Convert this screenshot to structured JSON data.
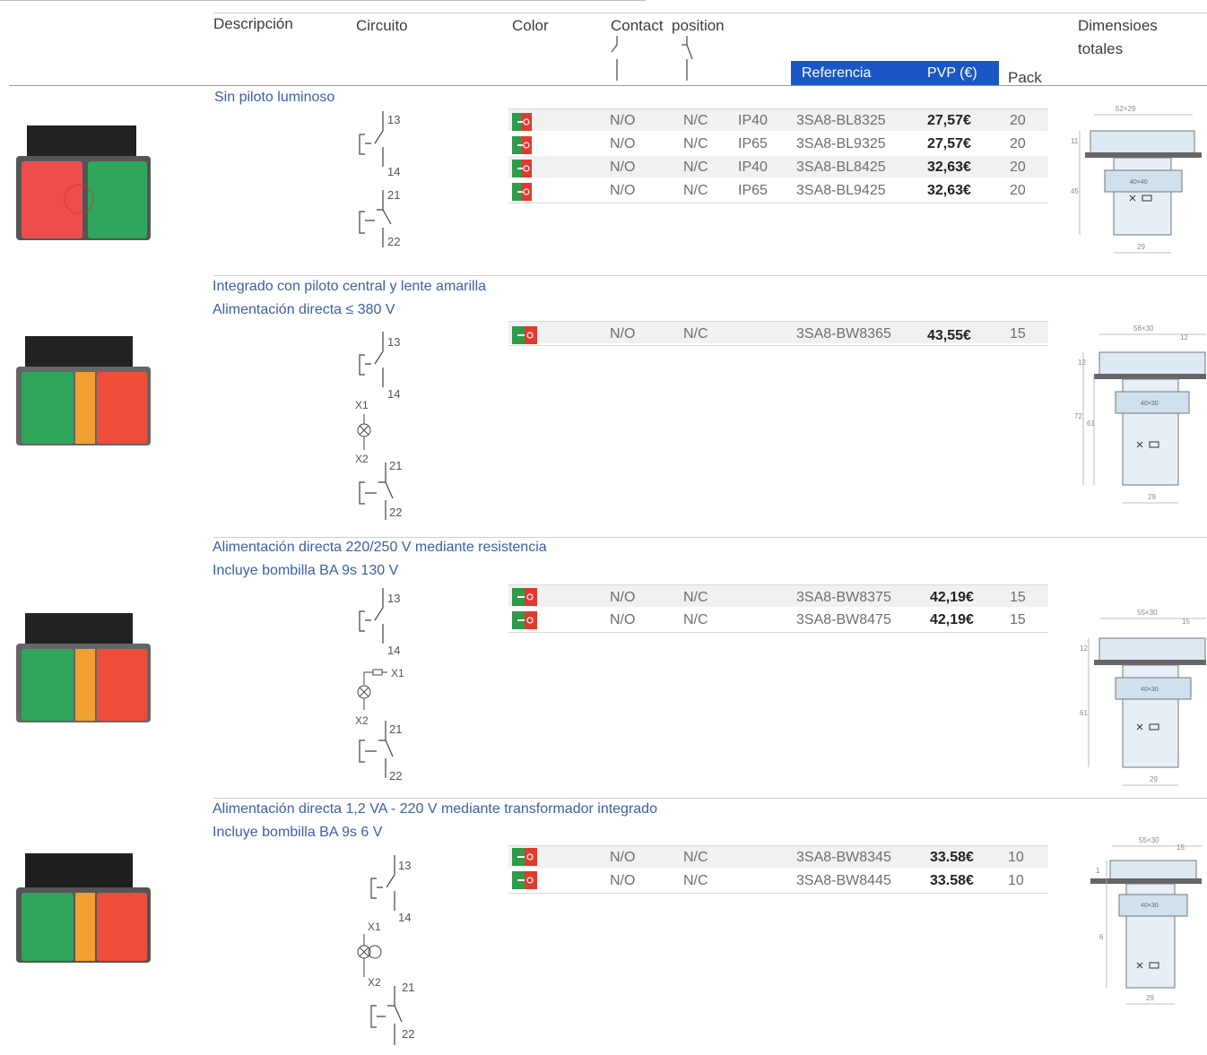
{
  "header": {
    "descripcion": "Descripción",
    "circuito": "Circuito",
    "color": "Color",
    "contact_position": "Contact  position",
    "referencia": "Referencia",
    "pvp": "PVP (€)",
    "pack": "Pack",
    "dimensiones_1": "Dimensioes",
    "dimensiones_2": "totales"
  },
  "colors": {
    "accent": "#1a57c4",
    "section_text": "#3b5fa6",
    "switch_green": "#2e9a4a",
    "switch_red": "#e03a2f"
  },
  "sections": [
    {
      "line1": "Sin piloto luminoso",
      "line2": "",
      "circuit_labels": [
        "13",
        "14",
        "21",
        "22"
      ],
      "rows": [
        {
          "no": "N/O",
          "nc": "N/C",
          "ip": "IP40",
          "ref": "3SA8-BL8325",
          "price": "27,57€",
          "pack": "20"
        },
        {
          "no": "N/O",
          "nc": "N/C",
          "ip": "IP65",
          "ref": "3SA8-BL9325",
          "price": "27,57€",
          "pack": "20"
        },
        {
          "no": "N/O",
          "nc": "N/C",
          "ip": "IP40",
          "ref": "3SA8-BL8425",
          "price": "32,63€",
          "pack": "20"
        },
        {
          "no": "N/O",
          "nc": "N/C",
          "ip": "IP65",
          "ref": "3SA8-BL9425",
          "price": "32,63€",
          "pack": "20"
        }
      ]
    },
    {
      "line1": "Integrado con piloto central y lente amarilla",
      "line2": "Alimentación directa ≤ 380 V",
      "circuit_labels": [
        "13",
        "14",
        "X1",
        "X2",
        "21",
        "22"
      ],
      "rows": [
        {
          "no": "N/O",
          "nc": "N/C",
          "ip": "",
          "ref": "3SA8-BW8365",
          "price": "43,55€",
          "pack": "15"
        }
      ]
    },
    {
      "line1": "Alimentación directa 220/250 V mediante resistencia",
      "line2": "Incluye bombilla BA 9s 130 V",
      "circuit_labels": [
        "13",
        "14",
        "X1",
        "X2",
        "21",
        "22"
      ],
      "rows": [
        {
          "no": "N/O",
          "nc": "N/C",
          "ip": "",
          "ref": "3SA8-BW8375",
          "price": "42,19€",
          "pack": "15"
        },
        {
          "no": "N/O",
          "nc": "N/C",
          "ip": "",
          "ref": "3SA8-BW8475",
          "price": "42,19€",
          "pack": "15"
        }
      ]
    },
    {
      "line1": "Alimentación directa 1,2 VA - 220 V mediante transformador integrado",
      "line2": "Incluye bombilla BA 9s 6 V",
      "circuit_labels": [
        "13",
        "14",
        "X1",
        "X2",
        "21",
        "22"
      ],
      "rows": [
        {
          "no": "N/O",
          "nc": "N/C",
          "ip": "",
          "ref": "3SA8-BW8345",
          "price": "33.58€",
          "pack": "10"
        },
        {
          "no": "N/O",
          "nc": "N/C",
          "ip": "",
          "ref": "3SA8-BW8445",
          "price": "33.58€",
          "pack": "10"
        }
      ]
    }
  ],
  "dimensions": [
    {
      "top": "52×29",
      "left_a": "11",
      "left_b": "45",
      "mid": "40×40",
      "bottom": "29"
    },
    {
      "top": "56×30",
      "right": "12",
      "left_a": "12",
      "left_b": "72",
      "left_c": "61",
      "mid": "40×30",
      "bottom": "29"
    },
    {
      "top": "55×30",
      "right": "15",
      "left_a": "12",
      "left_b": "61",
      "mid": "40×30",
      "bottom": "29"
    },
    {
      "top": "55×30",
      "right": "15",
      "left_a": "1",
      "left_b": "6",
      "mid": "40×30",
      "bottom": "29"
    }
  ]
}
